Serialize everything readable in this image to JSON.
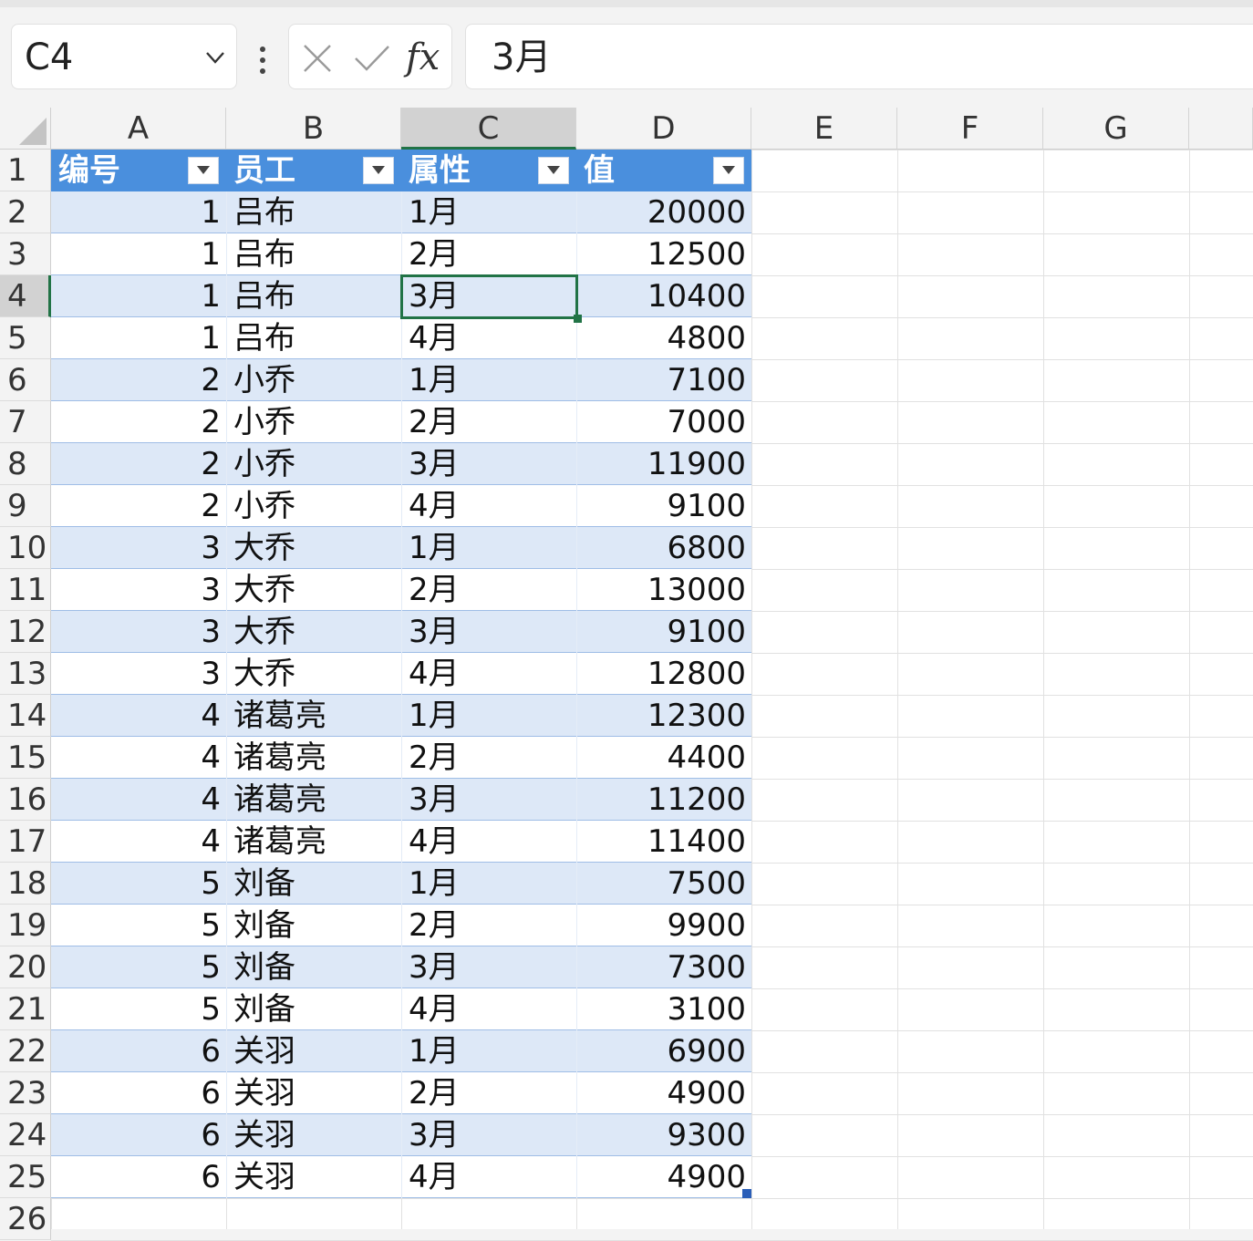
{
  "formula_bar": {
    "name_box": "C4",
    "fx_label": "fx",
    "formula_value": "3月"
  },
  "columns": [
    "A",
    "B",
    "C",
    "D",
    "E",
    "F",
    "G"
  ],
  "selected_column": "C",
  "selected_row": 4,
  "table": {
    "headers": [
      "编号",
      "员工",
      "属性",
      "值"
    ],
    "rows": [
      [
        "1",
        "吕布",
        "1月",
        "20000"
      ],
      [
        "1",
        "吕布",
        "2月",
        "12500"
      ],
      [
        "1",
        "吕布",
        "3月",
        "10400"
      ],
      [
        "1",
        "吕布",
        "4月",
        "4800"
      ],
      [
        "2",
        "小乔",
        "1月",
        "7100"
      ],
      [
        "2",
        "小乔",
        "2月",
        "7000"
      ],
      [
        "2",
        "小乔",
        "3月",
        "11900"
      ],
      [
        "2",
        "小乔",
        "4月",
        "9100"
      ],
      [
        "3",
        "大乔",
        "1月",
        "6800"
      ],
      [
        "3",
        "大乔",
        "2月",
        "13000"
      ],
      [
        "3",
        "大乔",
        "3月",
        "9100"
      ],
      [
        "3",
        "大乔",
        "4月",
        "12800"
      ],
      [
        "4",
        "诸葛亮",
        "1月",
        "12300"
      ],
      [
        "4",
        "诸葛亮",
        "2月",
        "4400"
      ],
      [
        "4",
        "诸葛亮",
        "3月",
        "11200"
      ],
      [
        "4",
        "诸葛亮",
        "4月",
        "11400"
      ],
      [
        "5",
        "刘备",
        "1月",
        "7500"
      ],
      [
        "5",
        "刘备",
        "2月",
        "9900"
      ],
      [
        "5",
        "刘备",
        "3月",
        "7300"
      ],
      [
        "5",
        "刘备",
        "4月",
        "3100"
      ],
      [
        "6",
        "关羽",
        "1月",
        "6900"
      ],
      [
        "6",
        "关羽",
        "2月",
        "4900"
      ],
      [
        "6",
        "关羽",
        "3月",
        "9300"
      ],
      [
        "6",
        "关羽",
        "4月",
        "4900"
      ]
    ]
  },
  "row_numbers": [
    "1",
    "2",
    "3",
    "4",
    "5",
    "6",
    "7",
    "8",
    "9",
    "10",
    "11",
    "12",
    "13",
    "14",
    "15",
    "16",
    "17",
    "18",
    "19",
    "20",
    "21",
    "22",
    "23",
    "24",
    "25",
    "26"
  ],
  "colors": {
    "table_header": "#4a8fdd",
    "band": "#dde8f7",
    "selection": "#217346"
  },
  "icons": {
    "name_box_dropdown": "chevron-down-icon",
    "cancel": "close-icon",
    "enter": "check-icon",
    "filter": "filter-dropdown-icon"
  }
}
